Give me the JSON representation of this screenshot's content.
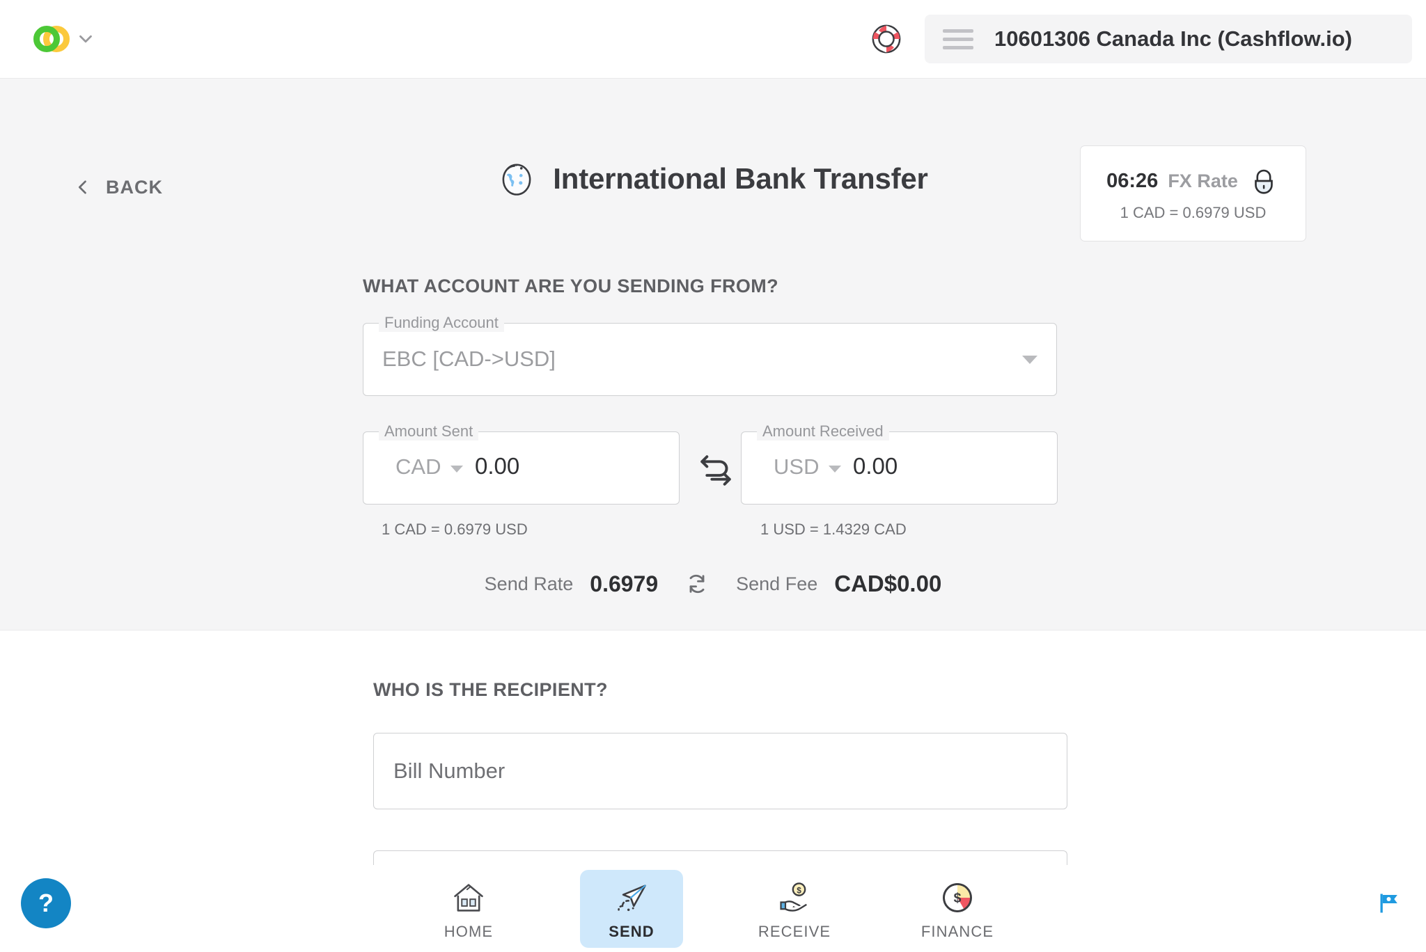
{
  "header": {
    "logo_icon": "cashflow-logo-icon",
    "brand_caret_icon": "chevron-down-icon",
    "support_icon": "lifebuoy-icon",
    "menu_icon": "hamburger-menu-icon",
    "account_name": "10601306 Canada Inc (Cashflow.io)",
    "account_caret_icon": "chevron-down-icon"
  },
  "page": {
    "back_label": "BACK",
    "back_icon": "chevron-left-icon",
    "title": "International Bank Transfer",
    "title_icon": "globe-icon"
  },
  "fx_card": {
    "timer": "06:26",
    "label": "FX Rate",
    "lock_icon": "padlock-icon",
    "rate_text": "1 CAD = 0.6979 USD"
  },
  "sending_from": {
    "section_title": "WHAT ACCOUNT ARE YOU SENDING FROM?",
    "funding_account": {
      "legend": "Funding Account",
      "value": "EBC [CAD->USD]",
      "caret_icon": "dropdown-caret-icon"
    },
    "amount_sent": {
      "legend": "Amount Sent",
      "currency": "CAD",
      "value": "0.00",
      "note": "1 CAD = 0.6979 USD",
      "caret_icon": "dropdown-caret-icon"
    },
    "amount_received": {
      "legend": "Amount Received",
      "currency": "USD",
      "value": "0.00",
      "note": "1 USD = 1.4329 CAD",
      "caret_icon": "dropdown-caret-icon"
    },
    "swap_icon": "swap-arrows-icon",
    "send_rate_label": "Send Rate",
    "send_rate_value": "0.6979",
    "refresh_icon": "refresh-icon",
    "send_fee_label": "Send Fee",
    "send_fee_value": "CAD$0.00"
  },
  "recipient": {
    "section_title": "WHO IS THE RECIPIENT?",
    "bill_number_placeholder": "Bill Number"
  },
  "bottom_nav": {
    "items": [
      {
        "label": "HOME",
        "icon": "house-icon",
        "active": false
      },
      {
        "label": "SEND",
        "icon": "paper-plane-icon",
        "active": true
      },
      {
        "label": "RECEIVE",
        "icon": "hand-coin-icon",
        "active": false
      },
      {
        "label": "FINANCE",
        "icon": "pie-chart-dollar-icon",
        "active": false
      }
    ]
  },
  "floating": {
    "help_label": "?",
    "help_icon": "question-mark-icon",
    "flag_icon": "flag-icon"
  },
  "colors": {
    "accent_blue": "#1385c4",
    "active_nav_bg": "#cfe8fb",
    "panel_grey": "#f5f5f6",
    "logo_green": "#4cc836",
    "logo_yellow": "#fbc93d"
  }
}
